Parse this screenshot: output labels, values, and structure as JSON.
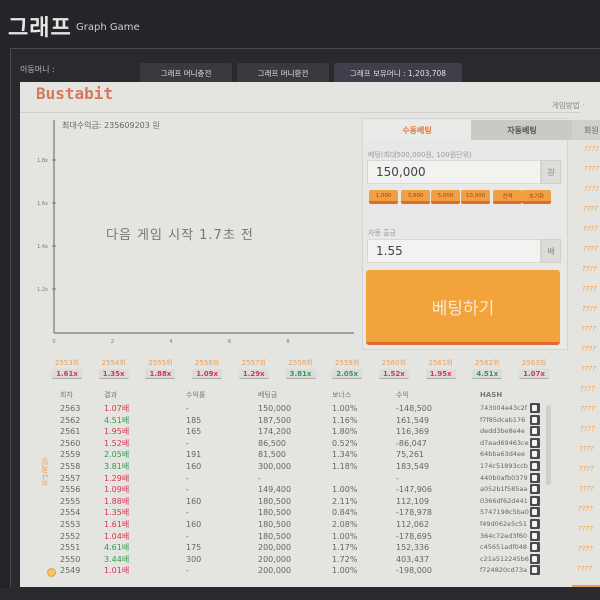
{
  "header": {
    "title": "그래프",
    "subtitle": "Graph Game"
  },
  "money_bar": {
    "label": "이동머니 :",
    "tabs": [
      {
        "label": "그래프 머니충전"
      },
      {
        "label": "그래프 머니환전"
      },
      {
        "label": "그래프 보유머니 : 1,203,708"
      }
    ]
  },
  "game": {
    "brand": "Bustabit",
    "how_to_label": "게임방법 ·"
  },
  "graph": {
    "max_profit": "최대수익금: 235609203 원",
    "status_text": "다음 게임 시작 1.7초 전",
    "y_ticks": [
      "1.8x",
      "1.6x",
      "1.4x",
      "1.2x"
    ],
    "x_ticks": [
      "0",
      "2",
      "4",
      "6",
      "8"
    ]
  },
  "betting": {
    "tabs": [
      {
        "label": "수동베팅",
        "active": true
      },
      {
        "label": "자동베팅",
        "active": false
      }
    ],
    "amount_label": "베팅(최대500,000원, 100원단위)",
    "amount_value": "150,000",
    "amount_unit": "원",
    "quick_buttons": [
      "1,000",
      "3,000",
      "5,000",
      "10,000",
      "전액",
      "초기화"
    ],
    "auto_cashout_label": "자동 출금",
    "auto_cashout_value": "1.55",
    "auto_cashout_unit": "배",
    "submit_label": "베팅하기"
  },
  "side_panel": {
    "header": "회원",
    "rows": [
      "????",
      "????",
      "????",
      "????",
      "????",
      "????",
      "????",
      "????",
      "????",
      "????",
      "????",
      "????",
      "????",
      "????",
      "????",
      "????",
      "????",
      "????",
      "????",
      "????",
      "????",
      "????"
    ]
  },
  "recent_rounds": [
    {
      "round": "2553회",
      "mult": "1.61x",
      "color": "red"
    },
    {
      "round": "2554회",
      "mult": "1.35x",
      "color": "red"
    },
    {
      "round": "2555회",
      "mult": "1.88x",
      "color": "red"
    },
    {
      "round": "2556회",
      "mult": "1.09x",
      "color": "red"
    },
    {
      "round": "2557회",
      "mult": "1.29x",
      "color": "red"
    },
    {
      "round": "2558회",
      "mult": "3.81x",
      "color": "green"
    },
    {
      "round": "2559회",
      "mult": "2.05x",
      "color": "green"
    },
    {
      "round": "2560회",
      "mult": "1.52x",
      "color": "red"
    },
    {
      "round": "2561회",
      "mult": "1.95x",
      "color": "red"
    },
    {
      "round": "2562회",
      "mult": "4.51x",
      "color": "green"
    },
    {
      "round": "2563회",
      "mult": "1.07x",
      "color": "red"
    }
  ],
  "history": {
    "side_label": "지난게임",
    "columns": [
      "회차",
      "결과",
      "수익률",
      "베팅금",
      "보너스",
      "수익",
      "HASH"
    ],
    "rows": [
      {
        "round": "2563",
        "result": "1.07배",
        "color": "red",
        "rate": "-",
        "bet": "150,000",
        "bonus": "1.00%",
        "profit": "-148,500",
        "hash": "743004e43c2f"
      },
      {
        "round": "2562",
        "result": "4.51배",
        "color": "green",
        "rate": "185",
        "bet": "187,500",
        "bonus": "1.16%",
        "profit": "161,549",
        "hash": "f7f85dcab176"
      },
      {
        "round": "2561",
        "result": "1.95배",
        "color": "red",
        "rate": "165",
        "bet": "174,200",
        "bonus": "1.80%",
        "profit": "116,369",
        "hash": "dedd3be8e4e"
      },
      {
        "round": "2560",
        "result": "1.52배",
        "color": "red",
        "rate": "-",
        "bet": "86,500",
        "bonus": "0.52%",
        "profit": "-86,047",
        "hash": "d7ead69463ce"
      },
      {
        "round": "2559",
        "result": "2.05배",
        "color": "green",
        "rate": "191",
        "bet": "81,500",
        "bonus": "1.34%",
        "profit": "75,261",
        "hash": "64bba63d4ee"
      },
      {
        "round": "2558",
        "result": "3.81배",
        "color": "green",
        "rate": "160",
        "bet": "300,000",
        "bonus": "1.18%",
        "profit": "183,549",
        "hash": "174c51893ccb"
      },
      {
        "round": "2557",
        "result": "1.29배",
        "color": "red",
        "rate": "-",
        "bet": "-",
        "bonus": "",
        "profit": "-",
        "hash": "440b0afb0379"
      },
      {
        "round": "2556",
        "result": "1.09배",
        "color": "red",
        "rate": "-",
        "bet": "149,400",
        "bonus": "1.00%",
        "profit": "-147,906",
        "hash": "a052b1f585aa"
      },
      {
        "round": "2555",
        "result": "1.88배",
        "color": "red",
        "rate": "160",
        "bet": "180,500",
        "bonus": "2.11%",
        "profit": "112,109",
        "hash": "0366df62d441"
      },
      {
        "round": "2554",
        "result": "1.35배",
        "color": "red",
        "rate": "-",
        "bet": "180,500",
        "bonus": "0.84%",
        "profit": "-178,978",
        "hash": "5747198c5ba0"
      },
      {
        "round": "2553",
        "result": "1.61배",
        "color": "red",
        "rate": "160",
        "bet": "180,500",
        "bonus": "2.08%",
        "profit": "112,062",
        "hash": "f49d062e5c51"
      },
      {
        "round": "2552",
        "result": "1.04배",
        "color": "red",
        "rate": "-",
        "bet": "180,500",
        "bonus": "1.00%",
        "profit": "-178,695",
        "hash": "364c72ed3f60"
      },
      {
        "round": "2551",
        "result": "4.61배",
        "color": "green",
        "rate": "175",
        "bet": "200,000",
        "bonus": "1.17%",
        "profit": "152,336",
        "hash": "c45651adf048"
      },
      {
        "round": "2550",
        "result": "3.44배",
        "color": "green",
        "rate": "300",
        "bet": "200,000",
        "bonus": "1.72%",
        "profit": "403,437",
        "hash": "c21a512245b6"
      },
      {
        "round": "2549",
        "result": "1.01배",
        "color": "red",
        "rate": "-",
        "bet": "200,000",
        "bonus": "1.00%",
        "profit": "-198,000",
        "hash": "f724820cd73a"
      }
    ]
  },
  "colors": {
    "accent_orange": "#f3a33c",
    "brand": "#d7785a",
    "loss_red": "#d8354f",
    "win_green": "#3a9a4a"
  }
}
